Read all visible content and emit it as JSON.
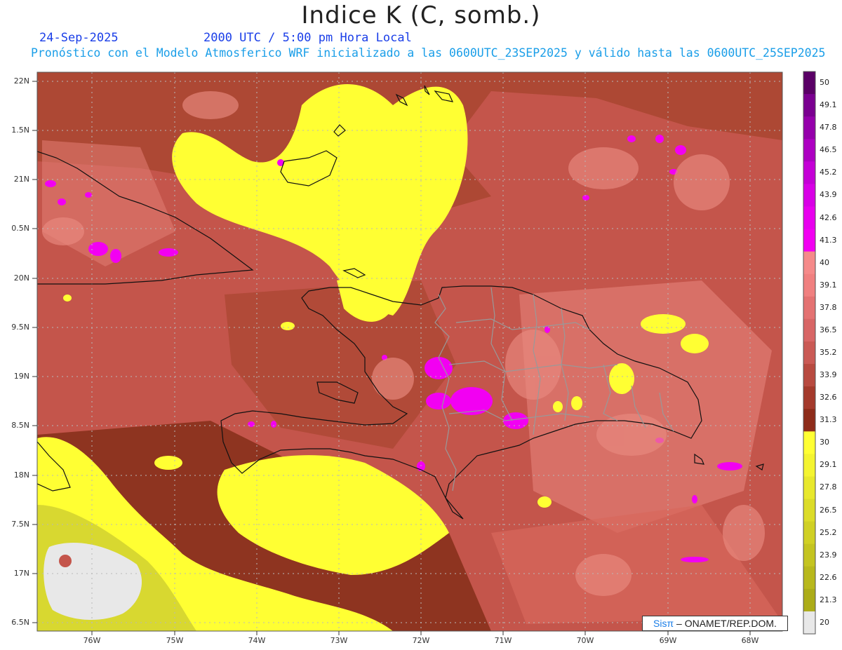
{
  "header": {
    "title": "Indice K (C, somb.)",
    "date": "24-Sep-2025",
    "time": "2000 UTC / 5:00 pm Hora Local",
    "subtitle": "Pronóstico con el Modelo Atmosferico WRF inicializado a las 0600UTC_23SEP2025 y válido hasta las  0600UTC_25SEP2025"
  },
  "axes": {
    "lat_labels": [
      "22N",
      "1.5N",
      "21N",
      "0.5N",
      "20N",
      "9.5N",
      "19N",
      "8.5N",
      "18N",
      "7.5N",
      "17N",
      "6.5N"
    ],
    "lon_labels": [
      "76W",
      "75W",
      "74W",
      "73W",
      "72W",
      "71W",
      "70W",
      "69W",
      "68W"
    ]
  },
  "colorbar": {
    "labels": [
      "50",
      "49.1",
      "47.8",
      "46.5",
      "45.2",
      "43.9",
      "42.6",
      "41.3",
      "40",
      "39.1",
      "37.8",
      "36.5",
      "35.2",
      "33.9",
      "32.6",
      "31.3",
      "30",
      "29.1",
      "27.8",
      "26.5",
      "25.2",
      "23.9",
      "22.6",
      "21.3",
      "20"
    ],
    "colors": [
      "#5a0066",
      "#7a0090",
      "#9500ab",
      "#ad00c2",
      "#c400d6",
      "#d800e6",
      "#e800ee",
      "#f200f2",
      "#f58a8a",
      "#f08080",
      "#e47272",
      "#d86666",
      "#ca5a55",
      "#b84a40",
      "#a43a2c",
      "#8e2c1a",
      "#ffff33",
      "#f4f430",
      "#e8e82c",
      "#dcdc28",
      "#d0d024",
      "#c4c420",
      "#b8b81c",
      "#acac18",
      "#e8e8e8"
    ]
  },
  "credit": {
    "sis": "Sisπ",
    "rest": " – ONAMET/REP.DOM."
  },
  "palette": {
    "base": "#c4554b",
    "dark": "#8e3420",
    "light": "#e07a70",
    "yellow": "#ffff33",
    "olive": "#d8d830",
    "magenta": "#f200f2",
    "gray_high": "#e8e8e8",
    "coast": "#111111",
    "border": "#999999"
  }
}
